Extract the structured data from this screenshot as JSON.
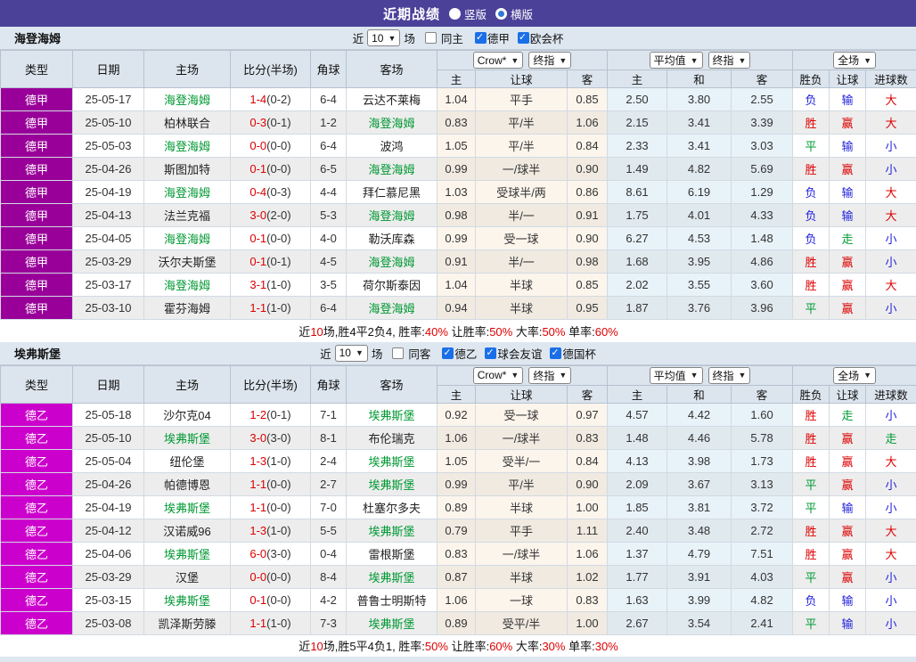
{
  "topbar": {
    "title": "近期战绩",
    "radio_vertical": "竖版",
    "radio_horizontal": "横版"
  },
  "labels": {
    "near": "近",
    "games": "场"
  },
  "table": {
    "col_type": "类型",
    "col_date": "日期",
    "col_home": "主场",
    "col_score": "比分(半场)",
    "col_corner": "角球",
    "col_away": "客场",
    "select_crow": "Crow*",
    "select_final": "终指",
    "select_avg": "平均值",
    "select_final2": "终指",
    "select_fulltime": "全场",
    "sub_home": "主",
    "sub_handicap": "让球",
    "sub_away": "客",
    "sub_avg_home": "主",
    "sub_avg_draw": "和",
    "sub_avg_away": "客",
    "sub_result": "胜负",
    "sub_result_handicap": "让球",
    "sub_goals": "进球数"
  },
  "colors": {
    "topbar": "#4c4199",
    "team_highlight": "#009933",
    "score_red": "#dd0000",
    "league": {
      "德甲": "#990099",
      "德乙": "#cc00cc"
    },
    "result": {
      "胜": "#dd0000",
      "赢": "#dd0000",
      "大": "#dd0000",
      "负": "#2222dd",
      "输": "#2222dd",
      "小": "#2222dd",
      "平": "#009933",
      "走": "#009933"
    }
  },
  "sections": [
    {
      "team": "海登海姆",
      "filter": {
        "count": "10",
        "venue_label": "同主",
        "venue_checked": false,
        "leagues": [
          "德甲",
          "欧会杯"
        ]
      },
      "rows": [
        {
          "league": "德甲",
          "date": "25-05-17",
          "home": "海登海姆",
          "score": "1-4",
          "half": "(0-2)",
          "corner": "6-4",
          "away": "云达不莱梅",
          "odds_home": "1.04",
          "handicap": "平手",
          "odds_away": "0.85",
          "avg_home": "2.50",
          "avg_draw": "3.80",
          "avg_away": "2.55",
          "result": "负",
          "result_handicap": "输",
          "goals": "大"
        },
        {
          "league": "德甲",
          "date": "25-05-10",
          "home": "柏林联合",
          "score": "0-3",
          "half": "(0-1)",
          "corner": "1-2",
          "away": "海登海姆",
          "odds_home": "0.83",
          "handicap": "平/半",
          "odds_away": "1.06",
          "avg_home": "2.15",
          "avg_draw": "3.41",
          "avg_away": "3.39",
          "result": "胜",
          "result_handicap": "赢",
          "goals": "大"
        },
        {
          "league": "德甲",
          "date": "25-05-03",
          "home": "海登海姆",
          "score": "0-0",
          "half": "(0-0)",
          "corner": "6-4",
          "away": "波鸿",
          "odds_home": "1.05",
          "handicap": "平/半",
          "odds_away": "0.84",
          "avg_home": "2.33",
          "avg_draw": "3.41",
          "avg_away": "3.03",
          "result": "平",
          "result_handicap": "输",
          "goals": "小"
        },
        {
          "league": "德甲",
          "date": "25-04-26",
          "home": "斯图加特",
          "score": "0-1",
          "half": "(0-0)",
          "corner": "6-5",
          "away": "海登海姆",
          "odds_home": "0.99",
          "handicap": "一/球半",
          "odds_away": "0.90",
          "avg_home": "1.49",
          "avg_draw": "4.82",
          "avg_away": "5.69",
          "result": "胜",
          "result_handicap": "赢",
          "goals": "小"
        },
        {
          "league": "德甲",
          "date": "25-04-19",
          "home": "海登海姆",
          "score": "0-4",
          "half": "(0-3)",
          "corner": "4-4",
          "away": "拜仁慕尼黑",
          "odds_home": "1.03",
          "handicap": "受球半/两",
          "odds_away": "0.86",
          "avg_home": "8.61",
          "avg_draw": "6.19",
          "avg_away": "1.29",
          "result": "负",
          "result_handicap": "输",
          "goals": "大"
        },
        {
          "league": "德甲",
          "date": "25-04-13",
          "home": "法兰克福",
          "score": "3-0",
          "half": "(2-0)",
          "corner": "5-3",
          "away": "海登海姆",
          "odds_home": "0.98",
          "handicap": "半/一",
          "odds_away": "0.91",
          "avg_home": "1.75",
          "avg_draw": "4.01",
          "avg_away": "4.33",
          "result": "负",
          "result_handicap": "输",
          "goals": "大"
        },
        {
          "league": "德甲",
          "date": "25-04-05",
          "home": "海登海姆",
          "score": "0-1",
          "half": "(0-0)",
          "corner": "4-0",
          "away": "勒沃库森",
          "odds_home": "0.99",
          "handicap": "受一球",
          "odds_away": "0.90",
          "avg_home": "6.27",
          "avg_draw": "4.53",
          "avg_away": "1.48",
          "result": "负",
          "result_handicap": "走",
          "goals": "小"
        },
        {
          "league": "德甲",
          "date": "25-03-29",
          "home": "沃尔夫斯堡",
          "score": "0-1",
          "half": "(0-1)",
          "corner": "4-5",
          "away": "海登海姆",
          "odds_home": "0.91",
          "handicap": "半/一",
          "odds_away": "0.98",
          "avg_home": "1.68",
          "avg_draw": "3.95",
          "avg_away": "4.86",
          "result": "胜",
          "result_handicap": "赢",
          "goals": "小"
        },
        {
          "league": "德甲",
          "date": "25-03-17",
          "home": "海登海姆",
          "score": "3-1",
          "half": "(1-0)",
          "corner": "3-5",
          "away": "荷尔斯泰因",
          "odds_home": "1.04",
          "handicap": "半球",
          "odds_away": "0.85",
          "avg_home": "2.02",
          "avg_draw": "3.55",
          "avg_away": "3.60",
          "result": "胜",
          "result_handicap": "赢",
          "goals": "大"
        },
        {
          "league": "德甲",
          "date": "25-03-10",
          "home": "霍芬海姆",
          "score": "1-1",
          "half": "(1-0)",
          "corner": "6-4",
          "away": "海登海姆",
          "odds_home": "0.94",
          "handicap": "半球",
          "odds_away": "0.95",
          "avg_home": "1.87",
          "avg_draw": "3.76",
          "avg_away": "3.96",
          "result": "平",
          "result_handicap": "赢",
          "goals": "小"
        }
      ],
      "summary_parts": [
        {
          "t": "近",
          "red": false
        },
        {
          "t": "10",
          "red": true
        },
        {
          "t": "场,胜4平2负4, 胜率:",
          "red": false
        },
        {
          "t": "40%",
          "red": true
        },
        {
          "t": " 让胜率:",
          "red": false
        },
        {
          "t": "50%",
          "red": true
        },
        {
          "t": " 大率:",
          "red": false
        },
        {
          "t": "50%",
          "red": true
        },
        {
          "t": " 单率:",
          "red": false
        },
        {
          "t": "60%",
          "red": true
        }
      ]
    },
    {
      "team": "埃弗斯堡",
      "filter": {
        "count": "10",
        "venue_label": "同客",
        "venue_checked": false,
        "leagues": [
          "德乙",
          "球会友谊",
          "德国杯"
        ]
      },
      "rows": [
        {
          "league": "德乙",
          "date": "25-05-18",
          "home": "沙尔克04",
          "score": "1-2",
          "half": "(0-1)",
          "corner": "7-1",
          "away": "埃弗斯堡",
          "odds_home": "0.92",
          "handicap": "受一球",
          "odds_away": "0.97",
          "avg_home": "4.57",
          "avg_draw": "4.42",
          "avg_away": "1.60",
          "result": "胜",
          "result_handicap": "走",
          "goals": "小"
        },
        {
          "league": "德乙",
          "date": "25-05-10",
          "home": "埃弗斯堡",
          "score": "3-0",
          "half": "(3-0)",
          "corner": "8-1",
          "away": "布伦瑞克",
          "odds_home": "1.06",
          "handicap": "一/球半",
          "odds_away": "0.83",
          "avg_home": "1.48",
          "avg_draw": "4.46",
          "avg_away": "5.78",
          "result": "胜",
          "result_handicap": "赢",
          "goals": "走"
        },
        {
          "league": "德乙",
          "date": "25-05-04",
          "home": "纽伦堡",
          "score": "1-3",
          "half": "(1-0)",
          "corner": "2-4",
          "away": "埃弗斯堡",
          "odds_home": "1.05",
          "handicap": "受半/一",
          "odds_away": "0.84",
          "avg_home": "4.13",
          "avg_draw": "3.98",
          "avg_away": "1.73",
          "result": "胜",
          "result_handicap": "赢",
          "goals": "大"
        },
        {
          "league": "德乙",
          "date": "25-04-26",
          "home": "帕德博恩",
          "score": "1-1",
          "half": "(0-0)",
          "corner": "2-7",
          "away": "埃弗斯堡",
          "odds_home": "0.99",
          "handicap": "平/半",
          "odds_away": "0.90",
          "avg_home": "2.09",
          "avg_draw": "3.67",
          "avg_away": "3.13",
          "result": "平",
          "result_handicap": "赢",
          "goals": "小"
        },
        {
          "league": "德乙",
          "date": "25-04-19",
          "home": "埃弗斯堡",
          "score": "1-1",
          "half": "(0-0)",
          "corner": "7-0",
          "away": "杜塞尔多夫",
          "odds_home": "0.89",
          "handicap": "半球",
          "odds_away": "1.00",
          "avg_home": "1.85",
          "avg_draw": "3.81",
          "avg_away": "3.72",
          "result": "平",
          "result_handicap": "输",
          "goals": "小"
        },
        {
          "league": "德乙",
          "date": "25-04-12",
          "home": "汉诺威96",
          "score": "1-3",
          "half": "(1-0)",
          "corner": "5-5",
          "away": "埃弗斯堡",
          "odds_home": "0.79",
          "handicap": "平手",
          "odds_away": "1.11",
          "avg_home": "2.40",
          "avg_draw": "3.48",
          "avg_away": "2.72",
          "result": "胜",
          "result_handicap": "赢",
          "goals": "大"
        },
        {
          "league": "德乙",
          "date": "25-04-06",
          "home": "埃弗斯堡",
          "score": "6-0",
          "half": "(3-0)",
          "corner": "0-4",
          "away": "雷根斯堡",
          "odds_home": "0.83",
          "handicap": "一/球半",
          "odds_away": "1.06",
          "avg_home": "1.37",
          "avg_draw": "4.79",
          "avg_away": "7.51",
          "result": "胜",
          "result_handicap": "赢",
          "goals": "大"
        },
        {
          "league": "德乙",
          "date": "25-03-29",
          "home": "汉堡",
          "score": "0-0",
          "half": "(0-0)",
          "corner": "8-4",
          "away": "埃弗斯堡",
          "odds_home": "0.87",
          "handicap": "半球",
          "odds_away": "1.02",
          "avg_home": "1.77",
          "avg_draw": "3.91",
          "avg_away": "4.03",
          "result": "平",
          "result_handicap": "赢",
          "goals": "小"
        },
        {
          "league": "德乙",
          "date": "25-03-15",
          "home": "埃弗斯堡",
          "score": "0-1",
          "half": "(0-0)",
          "corner": "4-2",
          "away": "普鲁士明斯特",
          "odds_home": "1.06",
          "handicap": "一球",
          "odds_away": "0.83",
          "avg_home": "1.63",
          "avg_draw": "3.99",
          "avg_away": "4.82",
          "result": "负",
          "result_handicap": "输",
          "goals": "小"
        },
        {
          "league": "德乙",
          "date": "25-03-08",
          "home": "凯泽斯劳滕",
          "score": "1-1",
          "half": "(1-0)",
          "corner": "7-3",
          "away": "埃弗斯堡",
          "odds_home": "0.89",
          "handicap": "受平/半",
          "odds_away": "1.00",
          "avg_home": "2.67",
          "avg_draw": "3.54",
          "avg_away": "2.41",
          "result": "平",
          "result_handicap": "输",
          "goals": "小"
        }
      ],
      "summary_parts": [
        {
          "t": "近",
          "red": false
        },
        {
          "t": "10",
          "red": true
        },
        {
          "t": "场,胜5平4负1, 胜率:",
          "red": false
        },
        {
          "t": "50%",
          "red": true
        },
        {
          "t": " 让胜率:",
          "red": false
        },
        {
          "t": "60%",
          "red": true
        },
        {
          "t": " 大率:",
          "red": false
        },
        {
          "t": "30%",
          "red": true
        },
        {
          "t": " 单率:",
          "red": false
        },
        {
          "t": "30%",
          "red": true
        }
      ]
    }
  ]
}
